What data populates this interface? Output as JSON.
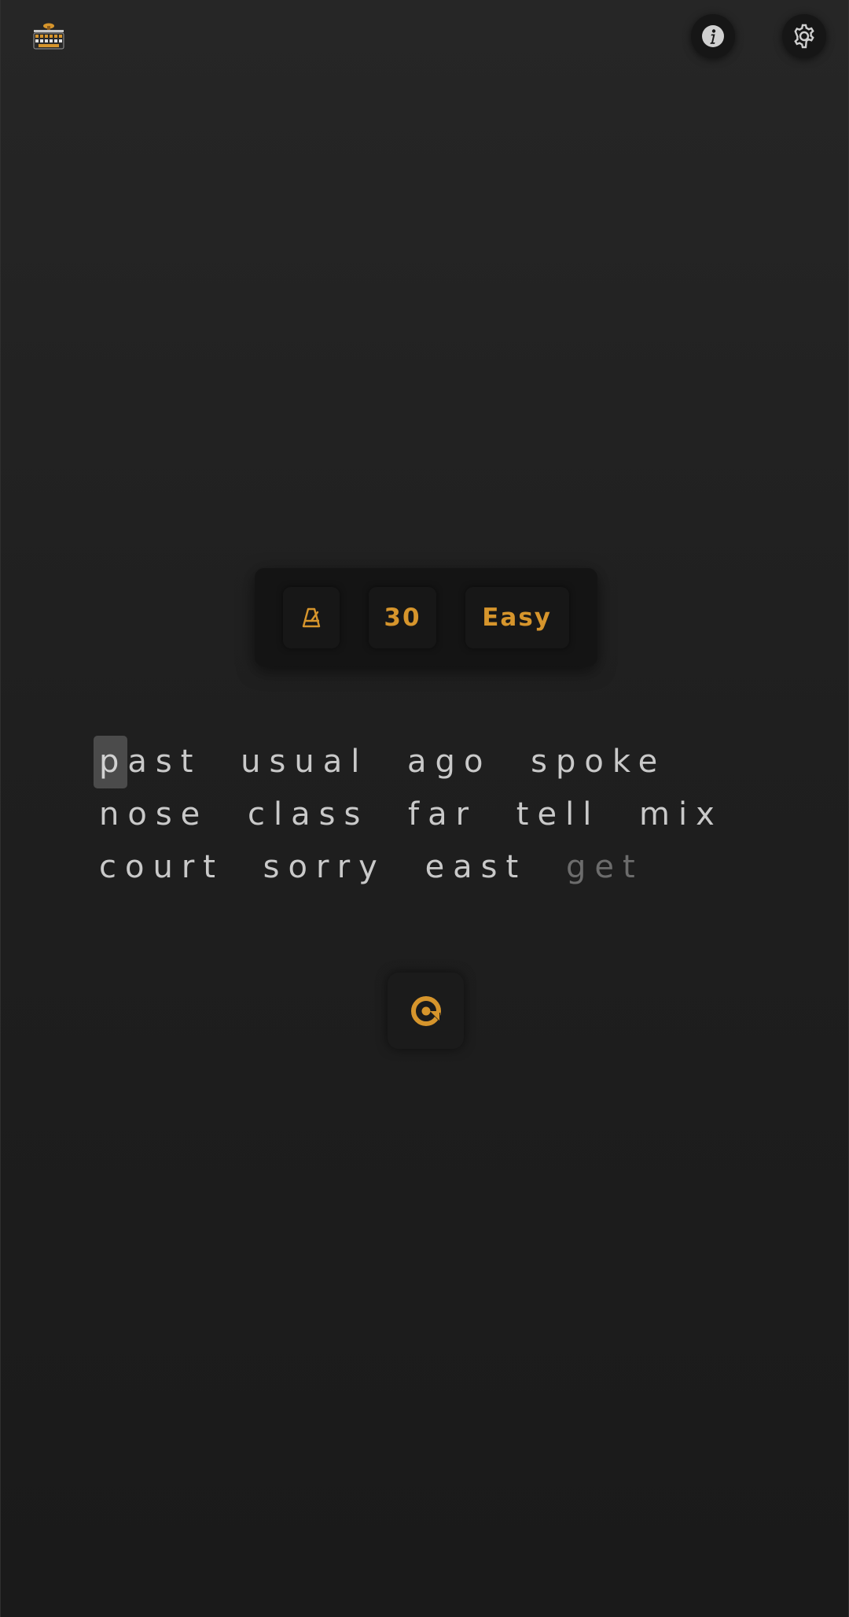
{
  "header": {
    "logo_icon": "keyboard-logo-icon",
    "info_icon": "info-icon",
    "settings_icon": "gear-icon"
  },
  "mode_bar": {
    "metronome_icon": "metronome-icon",
    "word_count": "30",
    "difficulty": "Easy"
  },
  "words": {
    "lines": [
      [
        {
          "text": "ast",
          "caret": "p",
          "state": "upcoming"
        },
        {
          "text": "usual",
          "state": "upcoming"
        },
        {
          "text": "ago",
          "state": "upcoming"
        },
        {
          "text": "spoke",
          "state": "upcoming"
        }
      ],
      [
        {
          "text": "nose",
          "state": "upcoming"
        },
        {
          "text": "class",
          "state": "upcoming"
        },
        {
          "text": "far",
          "state": "upcoming"
        },
        {
          "text": "tell",
          "state": "upcoming"
        },
        {
          "text": "mix",
          "state": "upcoming"
        }
      ],
      [
        {
          "text": "court",
          "state": "upcoming"
        },
        {
          "text": "sorry",
          "state": "upcoming"
        },
        {
          "text": "east",
          "state": "upcoming"
        },
        {
          "text": "get",
          "state": "pending"
        }
      ]
    ]
  },
  "restart": {
    "icon": "restart-icon"
  },
  "colors": {
    "accent": "#d6952c",
    "text": "#c9c9c9",
    "text_dim": "#6c6c6c",
    "caret_bg": "#4b4b4b"
  }
}
